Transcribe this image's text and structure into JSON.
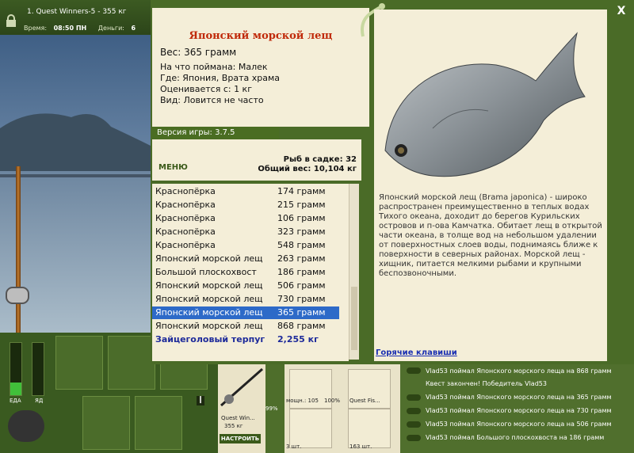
{
  "topbar": {
    "title": "1. Quest Winners-5 - 355 кг",
    "time_label": "Время:",
    "time_value": "08:50 ПН",
    "money_label": "Деньги:",
    "money_value": "6"
  },
  "fish": {
    "title": "Японский морской лещ",
    "weight": "Вес: 365 грамм",
    "caught_on": "На что поймана: Малек",
    "where": "Где: Япония, Врата храма",
    "rated_from": "Оценивается с: 1 кг",
    "kind": "Вид: Ловится не часто"
  },
  "version": "Версия игры: 3.7.5",
  "menu_label": "МЕНЮ",
  "catch": {
    "count": "Рыб в садке: 32",
    "total": "Общий вес: 10,104 кг"
  },
  "catch_list": [
    {
      "name": "Краснопёрка",
      "weight": "174 грамм"
    },
    {
      "name": "Краснопёрка",
      "weight": "215 грамм"
    },
    {
      "name": "Краснопёрка",
      "weight": "106 грамм"
    },
    {
      "name": "Краснопёрка",
      "weight": "323 грамм"
    },
    {
      "name": "Краснопёрка",
      "weight": "548 грамм"
    },
    {
      "name": "Японский морской лещ",
      "weight": "263 грамм"
    },
    {
      "name": "Большой плоскохвост",
      "weight": "186 грамм"
    },
    {
      "name": "Японский морской лещ",
      "weight": "506 грамм"
    },
    {
      "name": "Японский морской лещ",
      "weight": "730 грамм"
    },
    {
      "name": "Японский морской лещ",
      "weight": "365 грамм"
    },
    {
      "name": "Японский морской лещ",
      "weight": "868 грамм"
    },
    {
      "name": "Зайцеголовый терпуг",
      "weight": "2,255 кг"
    }
  ],
  "description": "Японский морской лещ (Brama japonica) - широко распространен преимущественно в теплых водах Тихого океана, доходит до берегов Курильских островов и п-ова Камчатка. Обитает лещ в открытой части океана, в толще вод на небольшом удалении от поверхностных слоев воды, поднимаясь ближе к поверхности в северных районах. Морской лещ - хищник, питается мелкими рыбами и крупными беспозвоночными.",
  "hotkeys": "Горячие клавиши",
  "close": "X",
  "gauges": {
    "food_label": "ЕДА",
    "poison_label": "ЯД"
  },
  "tackle": {
    "name": "Quest Win...",
    "weight": "355 кг",
    "percent": "99%",
    "setup_button": "НАСТРОИТЬ",
    "reel_label": "мощн.: 105",
    "reel_percent": "100%",
    "line_label": "Quest Fis...",
    "hooks_count": "3 шт.",
    "bait_count": "163 шт."
  },
  "log": [
    "Vlad53 поймал Японского морского леща на 868 грамм",
    "Квест закончен! Победитель Vlad53",
    "Vlad53 поймал Японского морского леща на 365 грамм",
    "Vlad53 поймал Японского морского леща на 730 грамм",
    "Vlad53 поймал Японского морского леща на 506 грамм",
    "Vlad53 поймал Большого плоскохвоста на 186 грамм"
  ]
}
